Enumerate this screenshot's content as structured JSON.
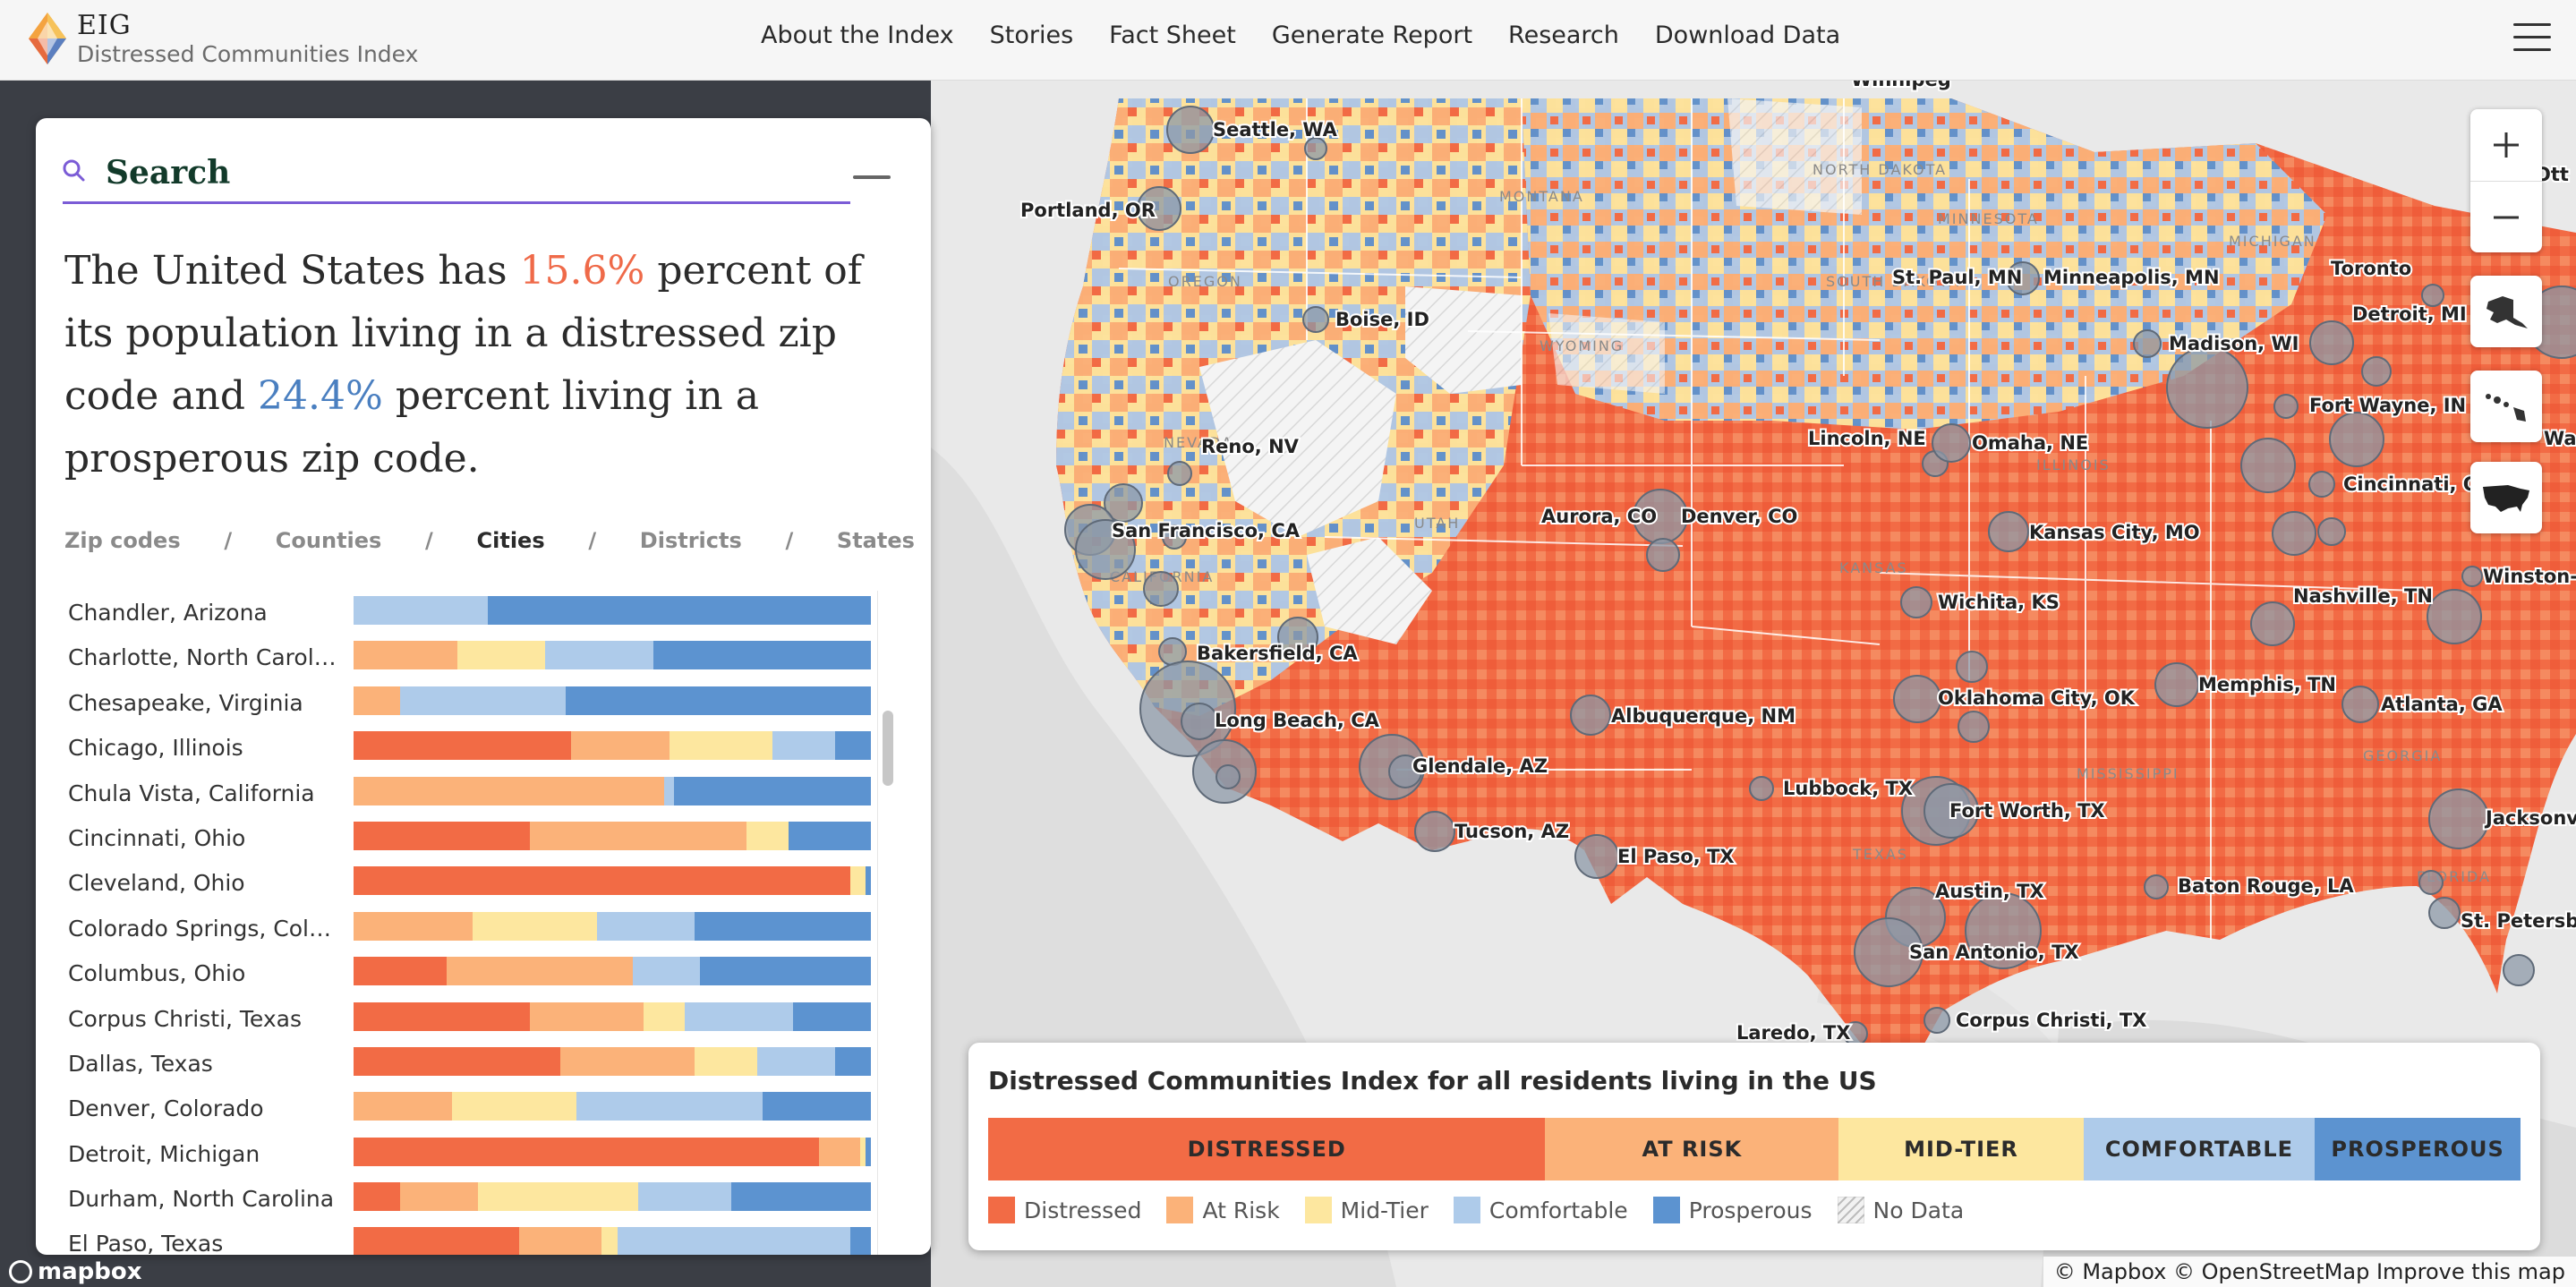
{
  "brand": {
    "title": "EIG",
    "subtitle": "Distressed Communities Index"
  },
  "nav": [
    "About the Index",
    "Stories",
    "Fact Sheet",
    "Generate Report",
    "Research",
    "Download Data"
  ],
  "search": {
    "label": "Search"
  },
  "headline": {
    "part1": "The United States has ",
    "distressed_pct": "15.6%",
    "part2": " percent of its population living in a distressed zip code and ",
    "prosperous_pct": "24.4%",
    "part3": " percent living in a prosperous zip code."
  },
  "geo_tabs": {
    "items": [
      "Zip codes",
      "Counties",
      "Cities",
      "Districts",
      "States"
    ],
    "separator": "/",
    "active": "Cities"
  },
  "colors": {
    "distressed": "#f26b45",
    "at_risk": "#fbb279",
    "mid_tier": "#fde79f",
    "comfortable": "#aecbea",
    "prosperous": "#5c93d0",
    "accent": "#7b5cd6"
  },
  "cities": [
    {
      "name": "Chandler, Arizona",
      "shares": [
        0,
        0,
        0,
        0.26,
        0.74
      ]
    },
    {
      "name": "Charlotte, North Carolina",
      "shares": [
        0,
        0.2,
        0.17,
        0.21,
        0.42
      ]
    },
    {
      "name": "Chesapeake, Virginia",
      "shares": [
        0,
        0.09,
        0,
        0.32,
        0.59
      ]
    },
    {
      "name": "Chicago, Illinois",
      "shares": [
        0.42,
        0.19,
        0.2,
        0.12,
        0.07
      ]
    },
    {
      "name": "Chula Vista, California",
      "shares": [
        0,
        0.6,
        0,
        0.02,
        0.38
      ]
    },
    {
      "name": "Cincinnati, Ohio",
      "shares": [
        0.34,
        0.42,
        0.08,
        0,
        0.16
      ]
    },
    {
      "name": "Cleveland, Ohio",
      "shares": [
        0.96,
        0,
        0.03,
        0,
        0.01
      ]
    },
    {
      "name": "Colorado Springs, Color...",
      "shares": [
        0,
        0.23,
        0.24,
        0.19,
        0.34
      ]
    },
    {
      "name": "Columbus, Ohio",
      "shares": [
        0.18,
        0.36,
        0,
        0.13,
        0.33
      ]
    },
    {
      "name": "Corpus Christi, Texas",
      "shares": [
        0.34,
        0.22,
        0.08,
        0.21,
        0.15
      ]
    },
    {
      "name": "Dallas, Texas",
      "shares": [
        0.4,
        0.26,
        0.12,
        0.15,
        0.07
      ]
    },
    {
      "name": "Denver, Colorado",
      "shares": [
        0,
        0.19,
        0.24,
        0.36,
        0.21
      ]
    },
    {
      "name": "Detroit, Michigan",
      "shares": [
        0.9,
        0.08,
        0.01,
        0,
        0.01
      ]
    },
    {
      "name": "Durham, North Carolina",
      "shares": [
        0.09,
        0.15,
        0.31,
        0.18,
        0.27
      ]
    },
    {
      "name": "El Paso, Texas",
      "shares": [
        0.32,
        0.16,
        0.03,
        0.45,
        0.04
      ]
    }
  ],
  "map": {
    "cities": [
      {
        "label": "Seattle, WA"
      },
      {
        "label": "Portland, OR"
      },
      {
        "label": "Boise, ID"
      },
      {
        "label": "Reno, NV"
      },
      {
        "label": "San Francisco, CA"
      },
      {
        "label": "Bakersfield, CA"
      },
      {
        "label": "Long Beach, CA"
      },
      {
        "label": "Glendale, AZ"
      },
      {
        "label": "Tucson, AZ"
      },
      {
        "label": "Aurora, CO"
      },
      {
        "label": "Denver, CO"
      },
      {
        "label": "Albuquerque, NM"
      },
      {
        "label": "El Paso, TX"
      },
      {
        "label": "Lubbock, TX"
      },
      {
        "label": "Fort Worth, TX"
      },
      {
        "label": "Austin, TX"
      },
      {
        "label": "San Antonio, TX"
      },
      {
        "label": "Laredo, TX"
      },
      {
        "label": "Corpus Christi, TX"
      },
      {
        "label": "Oklahoma City, OK"
      },
      {
        "label": "Wichita, KS"
      },
      {
        "label": "Kansas City, MO"
      },
      {
        "label": "Lincoln, NE"
      },
      {
        "label": "Omaha, NE"
      },
      {
        "label": "St. Paul, MN"
      },
      {
        "label": "Minneapolis, MN"
      },
      {
        "label": "Madison, WI"
      },
      {
        "label": "Detroit, MI"
      },
      {
        "label": "Toronto"
      },
      {
        "label": "Fort Wayne, IN"
      },
      {
        "label": "Cincinnati, OH"
      },
      {
        "label": "Nashville, TN"
      },
      {
        "label": "Memphis, TN"
      },
      {
        "label": "Atlanta, GA"
      },
      {
        "label": "Baton Rouge, LA"
      },
      {
        "label": "Jacksonvil"
      },
      {
        "label": "St. Petersbu"
      },
      {
        "label": "Winston-S"
      },
      {
        "label": "Was"
      },
      {
        "label": "Winnipeg"
      },
      {
        "label": "Ott"
      }
    ],
    "states": [
      "MONTANA",
      "NORTH DAKOTA",
      "MINNESOTA",
      "OREGON",
      "SOUTH DAKOTA",
      "WYOMING",
      "MICHIGAN",
      "UTAH",
      "KANSAS",
      "ILLINOIS",
      "CALIFORNIA",
      "TEXAS",
      "MISSISSIPPI",
      "GEORGIA",
      "FLORIDA",
      "NEVADA"
    ]
  },
  "legend": {
    "title": "Distressed Communities Index for all residents living in the US",
    "bar": [
      {
        "label": "DISTRESSED",
        "share": 0.3636
      },
      {
        "label": "AT RISK",
        "share": 0.1915
      },
      {
        "label": "MID-TIER",
        "share": 0.1597
      },
      {
        "label": "COMFORTABLE",
        "share": 0.151
      },
      {
        "label": "PROSPEROUS",
        "share": 0.1342
      }
    ],
    "keys": [
      "Distressed",
      "At Risk",
      "Mid-Tier",
      "Comfortable",
      "Prosperous",
      "No Data"
    ]
  },
  "attribution": "© Mapbox © OpenStreetMap  Improve this map",
  "mapbox_logo": "mapbox"
}
